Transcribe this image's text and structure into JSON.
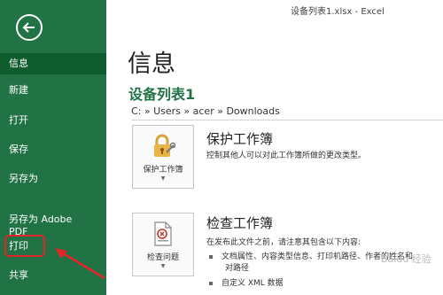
{
  "window": {
    "title": "设备列表1.xlsx - Excel"
  },
  "sidebar": {
    "items": [
      {
        "label": "信息",
        "active": true
      },
      {
        "label": "新建"
      },
      {
        "label": "打开"
      },
      {
        "label": "保存"
      },
      {
        "label": "另存为"
      },
      {
        "label": "另存为 Adobe\nPDF"
      },
      {
        "label": "打印",
        "highlighted": true
      },
      {
        "label": "共享"
      }
    ]
  },
  "main": {
    "page_title": "信息",
    "doc_name": "设备列表1",
    "path": "C: » Users » acer » Downloads",
    "sections": [
      {
        "tile_label": "保护工作簿",
        "tile_icon": "lock-key-icon",
        "title": "保护工作簿",
        "description": "控制其他人可以对此工作簿所做的更改类型。"
      },
      {
        "tile_label": "检查问题",
        "tile_icon": "inspect-document-icon",
        "title": "检查工作簿",
        "description": "在发布此文件之前，请注意其包含以下内容:",
        "bullets": [
          "文档属性、内容类型信息、打印机路径、作者的姓名和",
          "对路径",
          "自定义 XML 数据"
        ]
      }
    ]
  },
  "watermark": "Baidu 经验",
  "colors": {
    "brand": "#217346",
    "highlight": "#e0262a"
  }
}
